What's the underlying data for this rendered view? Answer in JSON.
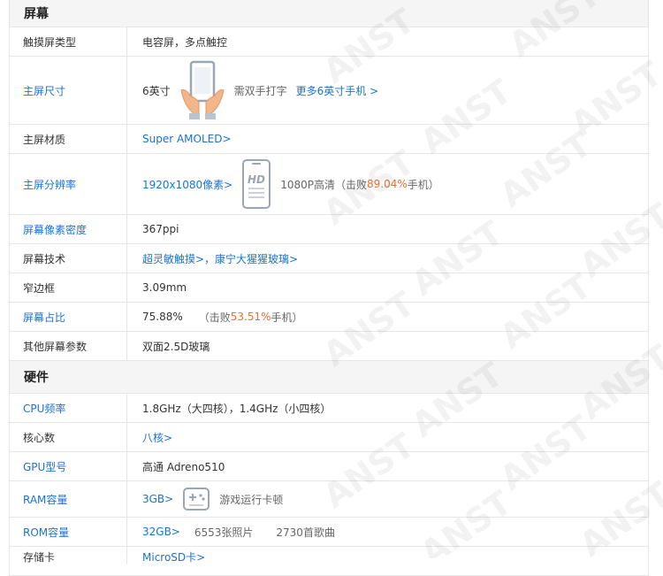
{
  "sections": {
    "screen": {
      "title": "屏幕",
      "rows": [
        {
          "label": "触摸屏类型",
          "value": "电容屏，多点触控"
        },
        {
          "label": "主屏尺寸",
          "value": "6英寸",
          "note": "需双手打字",
          "link": "更多6英寸手机 >"
        },
        {
          "label": "主屏材质",
          "value": "Super AMOLED>"
        },
        {
          "label": "主屏分辨率",
          "value": "1920x1080像素>",
          "badge": "HD",
          "note_prefix": "1080P高清（击败",
          "highlight": "89.04%",
          "note_suffix": "手机）"
        },
        {
          "label": "屏幕像素密度",
          "value": "367ppi"
        },
        {
          "label": "屏幕技术",
          "value": "超灵敏触摸>，康宁大猩猩玻璃>"
        },
        {
          "label": "窄边框",
          "value": "3.09mm"
        },
        {
          "label": "屏幕占比",
          "value": "75.88%",
          "note_prefix": "（击败",
          "highlight": "53.51%",
          "note_suffix": "手机）"
        },
        {
          "label": "其他屏幕参数",
          "value": "双面2.5D玻璃"
        }
      ]
    },
    "hardware": {
      "title": "硬件",
      "rows": [
        {
          "label": "CPU频率",
          "value": "1.8GHz（大四核），1.4GHz（小四核）"
        },
        {
          "label": "核心数",
          "value": "八核>"
        },
        {
          "label": "GPU型号",
          "value": "高通 Adreno510"
        },
        {
          "label": "RAM容量",
          "value": "3GB>",
          "note": "游戏运行卡顿"
        },
        {
          "label": "ROM容量",
          "value": "32GB>",
          "note1": "6553张照片",
          "note2": "2730首歌曲"
        },
        {
          "label": "存储卡",
          "value": "MicroSD卡>"
        }
      ]
    }
  },
  "watermark": {
    "text": "ANST"
  },
  "colors": {
    "link": "#1a73d1",
    "highlight": "#ee6b32",
    "border": "#e6e6e6",
    "header_bg": "#f5f5f5"
  }
}
